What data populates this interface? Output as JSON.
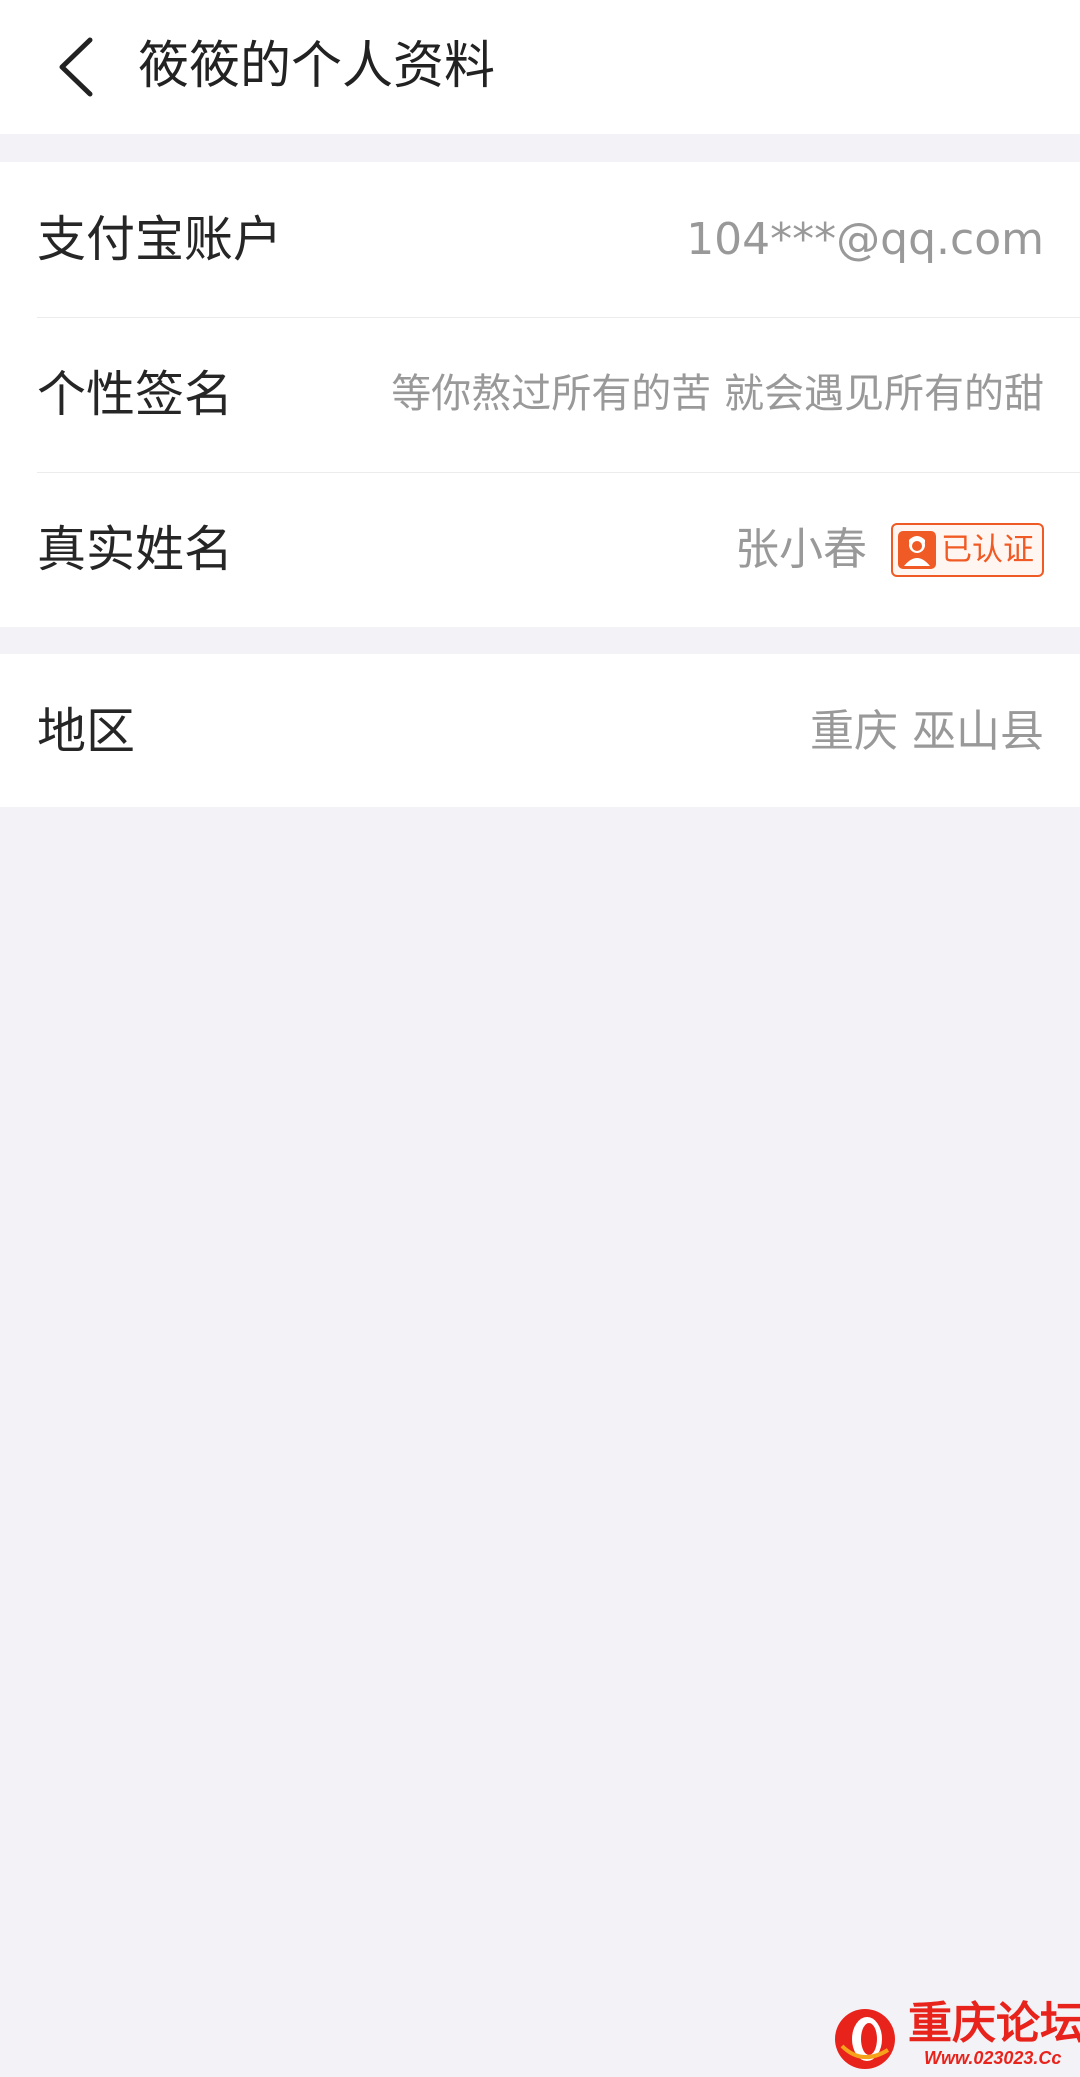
{
  "header": {
    "title": "筱筱的个人资料"
  },
  "profile": {
    "alipay": {
      "label": "支付宝账户",
      "value": "104***@qq.com"
    },
    "signature": {
      "label": "个性签名",
      "value": "等你熬过所有的苦 就会遇见所有的甜"
    },
    "real_name": {
      "label": "真实姓名",
      "value": "张小春",
      "badge": "已认证"
    },
    "region": {
      "label": "地区",
      "value": "重庆 巫山县"
    }
  },
  "watermark": {
    "name": "重庆论坛",
    "url": "Www.023023.Cc"
  },
  "colors": {
    "background": "#f3f3f7",
    "card": "#ffffff",
    "accent": "#f05a24",
    "value_text": "#999999",
    "label_text": "#262626"
  },
  "icons": {
    "back": "chevron-left-icon",
    "verified": "user-badge-icon"
  }
}
